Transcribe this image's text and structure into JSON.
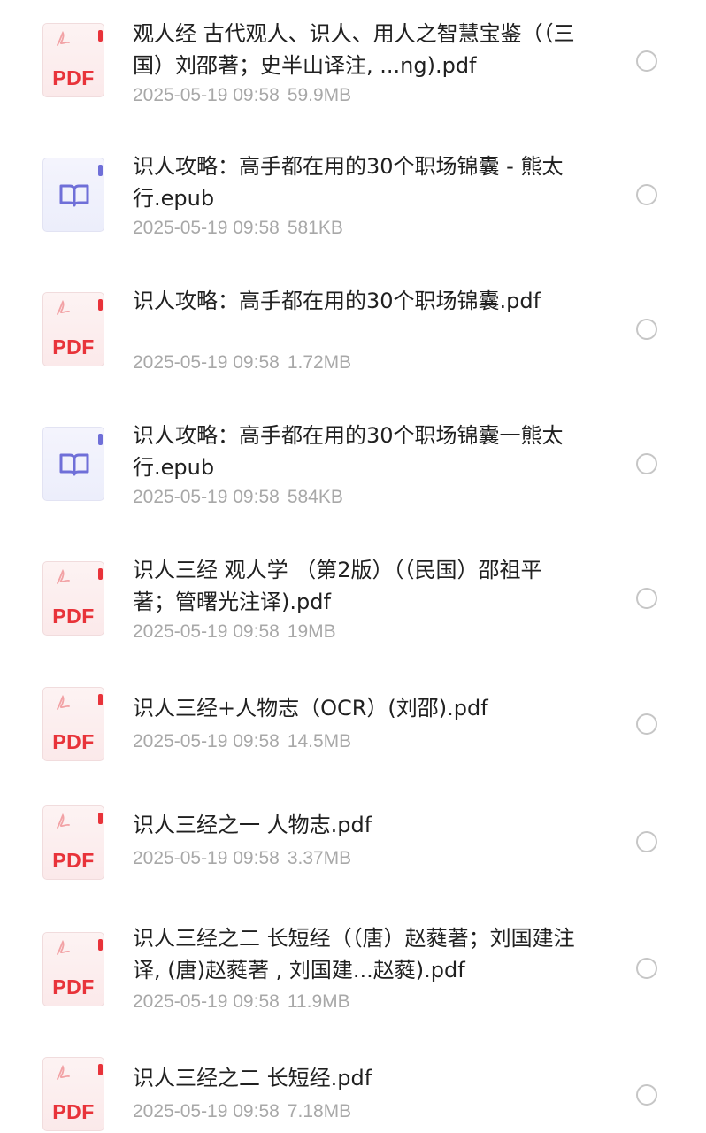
{
  "files": [
    {
      "type": "pdf",
      "icon": "pdf-file-icon",
      "icon_label": "PDF",
      "name": "观人经 古代观人、识人、用人之智慧宝鉴（（三国）刘邵著；史半山译注, ...ng).pdf",
      "date": "2025-05-19 09:58",
      "size": "59.9MB"
    },
    {
      "type": "epub",
      "icon": "epub-book-icon",
      "name": "识人攻略：高手都在用的30个职场锦囊 - 熊太行.epub",
      "date": "2025-05-19 09:58",
      "size": "581KB"
    },
    {
      "type": "pdf",
      "icon": "pdf-file-icon",
      "icon_label": "PDF",
      "name": "识人攻略：高手都在用的30个职场锦囊.pdf",
      "date": "2025-05-19 09:58",
      "size": "1.72MB"
    },
    {
      "type": "epub",
      "icon": "epub-book-icon",
      "name": "识人攻略：高手都在用的30个职场锦囊一熊太行.epub",
      "date": "2025-05-19 09:58",
      "size": "584KB"
    },
    {
      "type": "pdf",
      "icon": "pdf-file-icon",
      "icon_label": "PDF",
      "name": "识人三经 观人学 （第2版）（（民国）邵祖平著；管曙光注译).pdf",
      "date": "2025-05-19 09:58",
      "size": "19MB"
    },
    {
      "type": "pdf",
      "icon": "pdf-file-icon",
      "icon_label": "PDF",
      "name": "识人三经+人物志（OCR）(刘邵).pdf",
      "date": "2025-05-19 09:58",
      "size": "14.5MB"
    },
    {
      "type": "pdf",
      "icon": "pdf-file-icon",
      "icon_label": "PDF",
      "name": "识人三经之一 人物志.pdf",
      "date": "2025-05-19 09:58",
      "size": "3.37MB"
    },
    {
      "type": "pdf",
      "icon": "pdf-file-icon",
      "icon_label": "PDF",
      "name": "识人三经之二 长短经（（唐）赵蕤著；刘国建注译, (唐)赵蕤著 , 刘国建...赵蕤).pdf",
      "date": "2025-05-19 09:58",
      "size": "11.9MB"
    },
    {
      "type": "pdf",
      "icon": "pdf-file-icon",
      "icon_label": "PDF",
      "name": "识人三经之二 长短经.pdf",
      "date": "2025-05-19 09:58",
      "size": "7.18MB"
    }
  ],
  "colors": {
    "pdf_accent": "#e8333a",
    "epub_accent": "#6f6fd8",
    "name_text": "#202020",
    "meta_text": "#a8a8a8",
    "radio_border": "#c6c6c6"
  }
}
